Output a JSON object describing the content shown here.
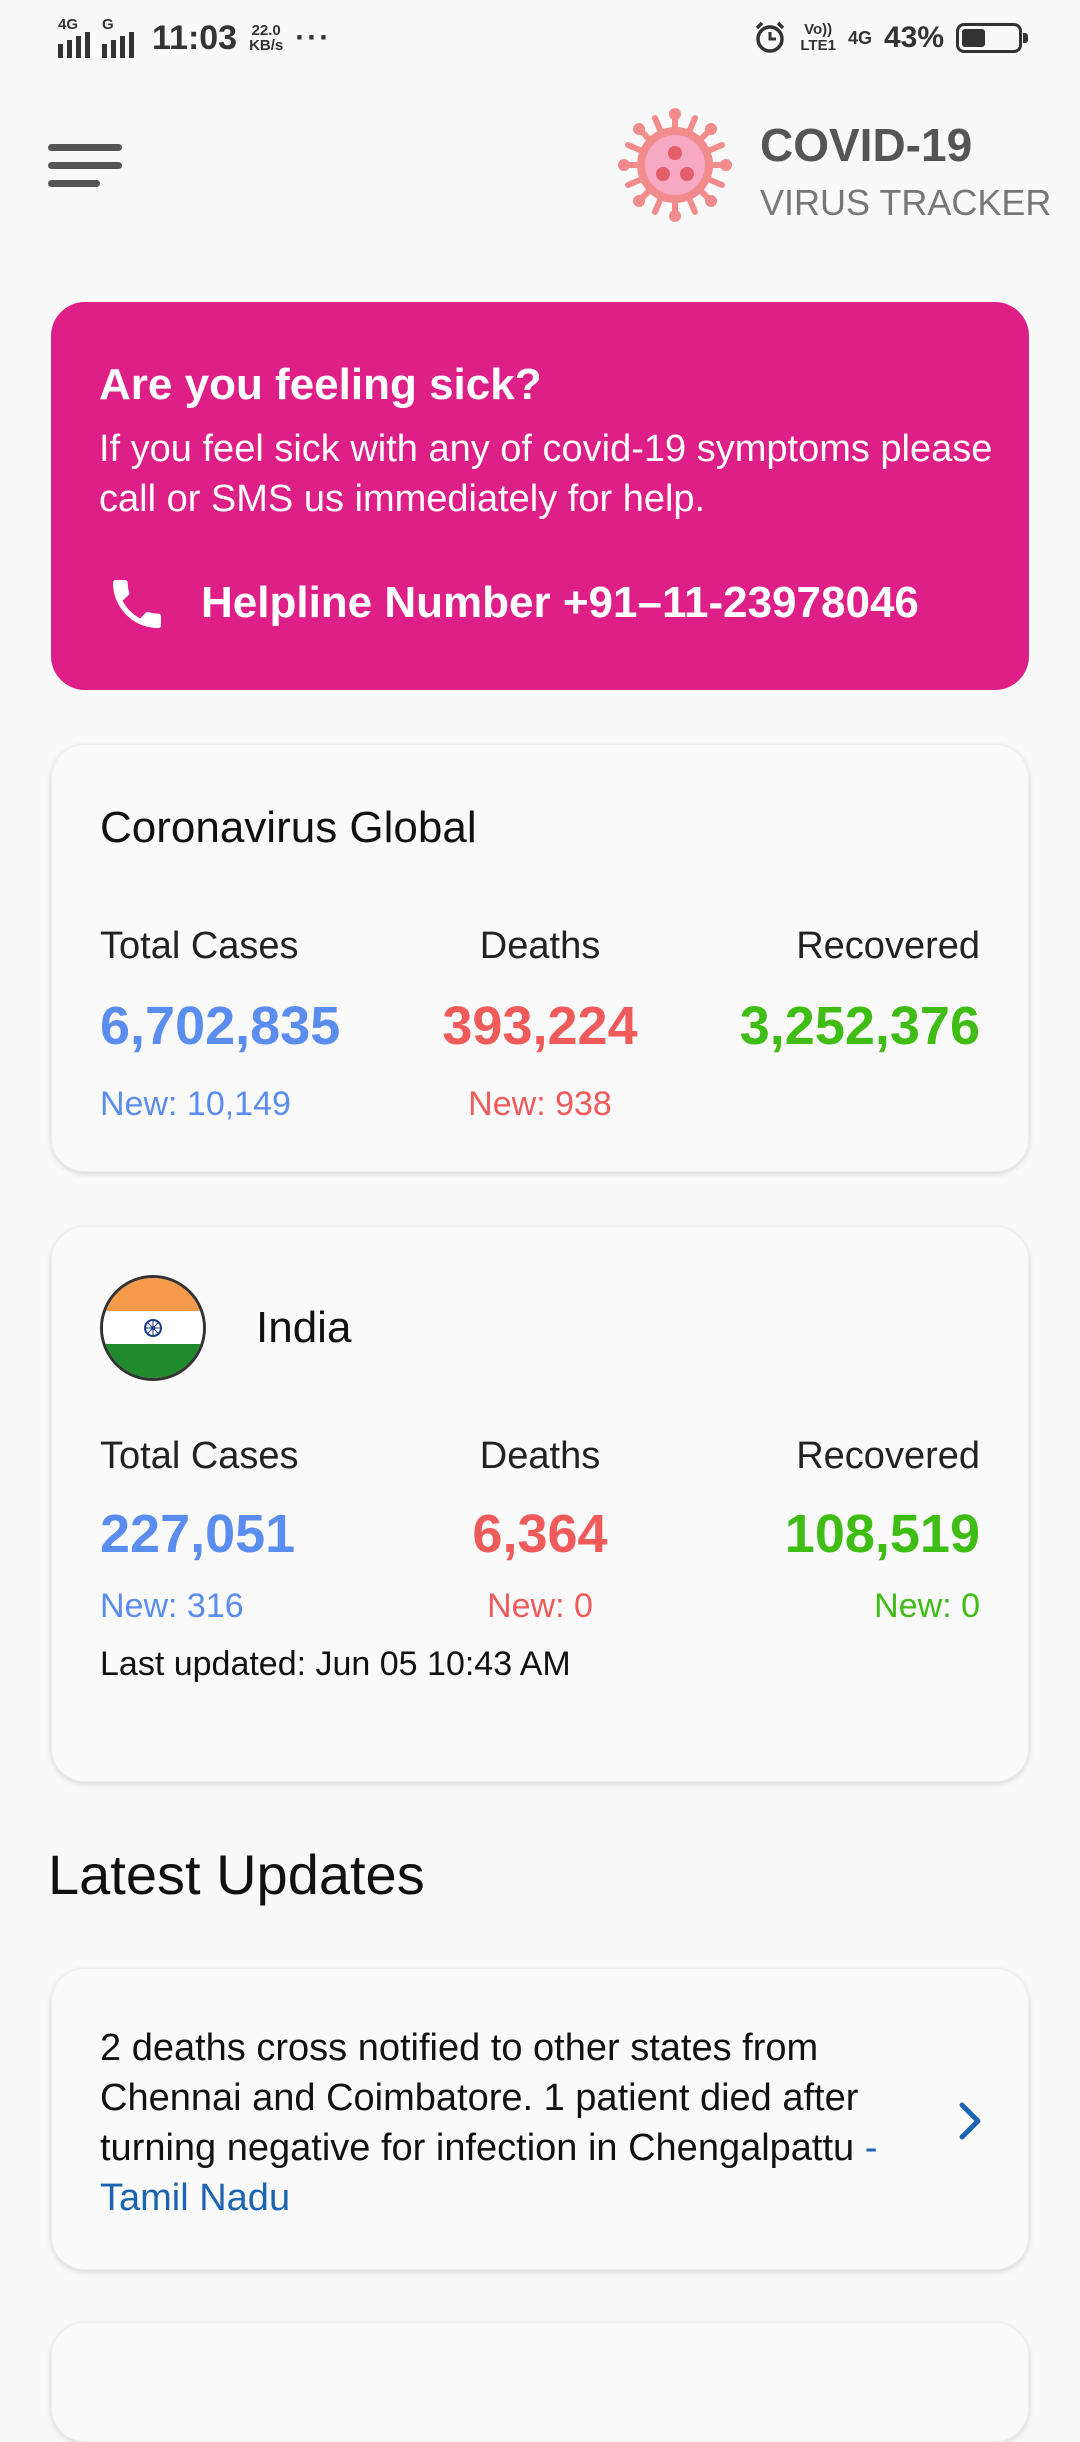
{
  "status_bar": {
    "net1": "4G",
    "net2": "G",
    "time": "11:03",
    "speed_value": "22.0",
    "speed_unit": "KB/s",
    "more": "···",
    "volte_top": "Vo))",
    "volte_bottom": "LTE1",
    "net_type": "4G",
    "battery_pct": "43%",
    "battery_level": 0.43
  },
  "header": {
    "menu_icon": "hamburger-menu-icon",
    "logo_icon": "virus-icon",
    "title": "COVID-19",
    "subtitle": "VIRUS TRACKER"
  },
  "sick_card": {
    "title": "Are you feeling sick?",
    "text": "If you feel sick with any of covid-19 symptoms please call or SMS us immediately for help.",
    "phone_icon": "phone-icon",
    "helpline": "Helpline Number +91–11-23978046",
    "bg_color": "#de1f87"
  },
  "global": {
    "title": "Coronavirus Global",
    "total_label": "Total Cases",
    "total_value": "6,702,835",
    "total_new": "New: 10,149",
    "deaths_label": "Deaths",
    "deaths_value": "393,224",
    "deaths_new": "New: 938",
    "recovered_label": "Recovered",
    "recovered_value": "3,252,376"
  },
  "india": {
    "flag_icon": "india-flag-icon",
    "title": "India",
    "total_label": "Total Cases",
    "total_value": "227,051",
    "total_new": "New: 316",
    "deaths_label": "Deaths",
    "deaths_value": "6,364",
    "deaths_new": "New: 0",
    "recovered_label": "Recovered",
    "recovered_value": "108,519",
    "recovered_new": "New: 0",
    "last_updated": "Last updated: Jun 05 10:43 AM"
  },
  "latest": {
    "heading": "Latest Updates",
    "items": [
      {
        "text": "2 deaths cross notified to other states from Chennai and Coimbatore. 1 patient died after turning negative for infection in Chengalpattu",
        "source": "- Tamil Nadu",
        "icon": "chevron-right-icon"
      }
    ]
  },
  "colors": {
    "cases": "#5b8def",
    "deaths": "#ef5a5a",
    "recovered": "#3fbd14",
    "link": "#1b63b3"
  }
}
